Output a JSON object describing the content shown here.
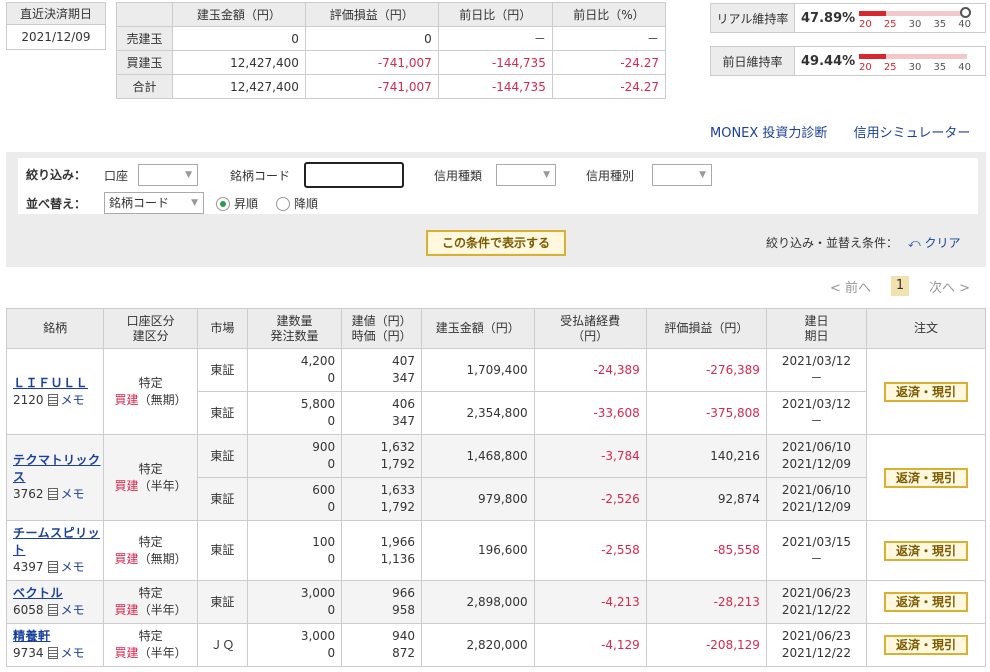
{
  "settlement": {
    "label": "直近決済期日",
    "date": "2021/12/09"
  },
  "summary": {
    "headers": [
      "",
      "建玉金額（円）",
      "評価損益（円）",
      "前日比（円）",
      "前日比（%）"
    ],
    "rows": [
      {
        "label": "売建玉",
        "amount": "0",
        "pl": "0",
        "diff": "－",
        "pct": "－"
      },
      {
        "label": "買建玉",
        "amount": "12,427,400",
        "pl": "-741,007",
        "diff": "-144,735",
        "pct": "-24.27"
      },
      {
        "label": "合計",
        "amount": "12,427,400",
        "pl": "-741,007",
        "diff": "-144,735",
        "pct": "-24.27"
      }
    ]
  },
  "ratios": [
    {
      "label": "リアル維持率",
      "value": "47.89%",
      "ticks": [
        "20",
        "25",
        "30",
        "35",
        "40"
      ],
      "level_pct": 47.89
    },
    {
      "label": "前日維持率",
      "value": "49.44%",
      "ticks": [
        "20",
        "25",
        "30",
        "35",
        "40"
      ],
      "level_pct": 49.44
    }
  ],
  "links": {
    "monex": "MONEX 投資力診断",
    "sim": "信用シミュレーター"
  },
  "filter": {
    "narrow_label": "絞り込み：",
    "account_label": "口座",
    "code_label": "銘柄コード",
    "credit_kind_label": "信用種類",
    "credit_type_label": "信用種別",
    "sort_label": "並べ替え：",
    "sort_value": "銘柄コード",
    "asc": "昇順",
    "desc": "降順",
    "show_button": "この条件で表示する",
    "cond_label": "絞り込み・並替え条件：",
    "clear": "クリア"
  },
  "pager": {
    "prev": "< 前へ",
    "current": "1",
    "next": "次へ >"
  },
  "table": {
    "headers": {
      "stock": "銘柄",
      "acct1": "口座区分",
      "acct2": "建区分",
      "market": "市場",
      "qty1": "建数量",
      "qty2": "発注数量",
      "price1": "建値（円）",
      "price2": "時価（円）",
      "amount": "建玉金額（円）",
      "fee1": "受払諸経費",
      "fee2": "（円）",
      "pl": "評価損益（円）",
      "date1": "建日",
      "date2": "期日",
      "order": "注文"
    },
    "memo": "メモ",
    "order_btn": "返済・現引",
    "stocks": [
      {
        "name": "ＬＩＦＵＬＬ",
        "code": "2120",
        "acct": "特定",
        "kind": "買建",
        "term": "（無期）",
        "rows": [
          {
            "market": "東証",
            "qty": "4,200",
            "order_qty": "0",
            "price": "407",
            "cur": "347",
            "amount": "1,709,400",
            "fee": "-24,389",
            "pl": "-276,389",
            "date": "2021/03/12",
            "due": "－"
          },
          {
            "market": "東証",
            "qty": "5,800",
            "order_qty": "0",
            "price": "406",
            "cur": "347",
            "amount": "2,354,800",
            "fee": "-33,608",
            "pl": "-375,808",
            "date": "2021/03/12",
            "due": "－"
          }
        ]
      },
      {
        "name": "テクマトリックス",
        "code": "3762",
        "acct": "特定",
        "kind": "買建",
        "term": "（半年）",
        "rows": [
          {
            "market": "東証",
            "qty": "900",
            "order_qty": "0",
            "price": "1,632",
            "cur": "1,792",
            "amount": "1,468,800",
            "fee": "-3,784",
            "pl": "140,216",
            "date": "2021/06/10",
            "due": "2021/12/09"
          },
          {
            "market": "東証",
            "qty": "600",
            "order_qty": "0",
            "price": "1,633",
            "cur": "1,792",
            "amount": "979,800",
            "fee": "-2,526",
            "pl": "92,874",
            "date": "2021/06/10",
            "due": "2021/12/09"
          }
        ]
      },
      {
        "name": "チームスピリット",
        "code": "4397",
        "acct": "特定",
        "kind": "買建",
        "term": "（無期）",
        "rows": [
          {
            "market": "東証",
            "qty": "100",
            "order_qty": "0",
            "price": "1,966",
            "cur": "1,136",
            "amount": "196,600",
            "fee": "-2,558",
            "pl": "-85,558",
            "date": "2021/03/15",
            "due": "－"
          }
        ]
      },
      {
        "name": "ベクトル",
        "code": "6058",
        "acct": "特定",
        "kind": "買建",
        "term": "（半年）",
        "rows": [
          {
            "market": "東証",
            "qty": "3,000",
            "order_qty": "0",
            "price": "966",
            "cur": "958",
            "amount": "2,898,000",
            "fee": "-4,213",
            "pl": "-28,213",
            "date": "2021/06/23",
            "due": "2021/12/22"
          }
        ]
      },
      {
        "name": "精養軒",
        "code": "9734",
        "acct": "特定",
        "kind": "買建",
        "term": "（半年）",
        "rows": [
          {
            "market": "ＪＱ",
            "qty": "3,000",
            "order_qty": "0",
            "price": "940",
            "cur": "872",
            "amount": "2,820,000",
            "fee": "-4,129",
            "pl": "-208,129",
            "date": "2021/06/23",
            "due": "2021/12/22"
          }
        ]
      }
    ]
  }
}
